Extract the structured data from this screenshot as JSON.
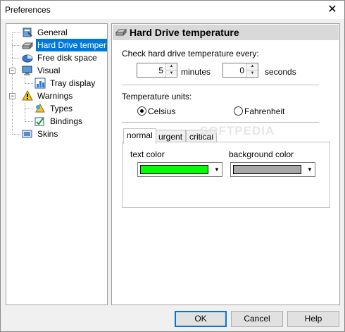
{
  "window": {
    "title": "Preferences",
    "close_glyph": "✕"
  },
  "tree": {
    "items": [
      {
        "label": "General",
        "icon": "wrench-icon"
      },
      {
        "label": "Hard Drive temper",
        "icon": "hard-drive-icon",
        "selected": true
      },
      {
        "label": "Free disk space",
        "icon": "pie-chart-icon"
      },
      {
        "label": "Visual",
        "icon": "monitor-icon"
      },
      {
        "label": "Tray display",
        "icon": "tray-chart-icon"
      },
      {
        "label": "Warnings",
        "icon": "warning-icon"
      },
      {
        "label": "Types",
        "icon": "warning-types-icon"
      },
      {
        "label": "Bindings",
        "icon": "bindings-icon"
      },
      {
        "label": "Skins",
        "icon": "skins-icon"
      }
    ],
    "expander_minus": "−"
  },
  "panel": {
    "header_title": "Hard Drive temperature",
    "check_label": "Check hard drive temperature every:",
    "minutes_value": "5",
    "minutes_label": "minutes",
    "seconds_value": "0",
    "seconds_label": "seconds",
    "units_label": "Temperature units:",
    "celsius_label": "Celsius",
    "fahrenheit_label": "Fahrenheit",
    "selected_unit": "Celsius",
    "tabs": [
      "normal",
      "urgent",
      "critical"
    ],
    "active_tab": "normal",
    "text_color_label": "text color",
    "background_color_label": "background color",
    "text_color": "#00ff00",
    "background_color": "#a8a8a8",
    "watermark": "SOFTPEDIA"
  },
  "buttons": {
    "ok": "OK",
    "cancel": "Cancel",
    "help": "Help"
  },
  "colors": {
    "selection": "#0078d7",
    "header_bg": "#d9d9d9"
  }
}
